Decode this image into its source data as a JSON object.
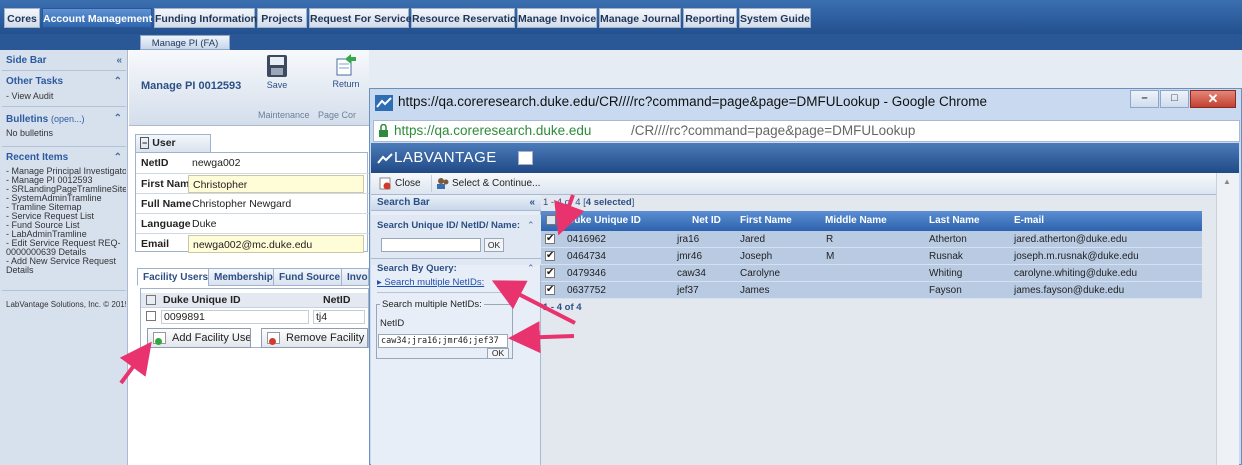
{
  "topnav": {
    "tabs": [
      {
        "label": "Cores"
      },
      {
        "label": "Account Management",
        "active": true
      },
      {
        "label": "Funding Information"
      },
      {
        "label": "Projects"
      },
      {
        "label": "Request For Service"
      },
      {
        "label": "Resource Reservation"
      },
      {
        "label": "Manage Invoice"
      },
      {
        "label": "Manage Journal"
      },
      {
        "label": "Reporting"
      },
      {
        "label": "System Guide"
      }
    ],
    "subtab": "Manage PI (FA)"
  },
  "sidebar": {
    "title": "Side Bar",
    "other_tasks_title": "Other Tasks",
    "other_tasks": [
      "- View Audit"
    ],
    "bulletins_title": "Bulletins",
    "bulletins_open": "(open...)",
    "bulletins_text": "No bulletins",
    "recent_title": "Recent Items",
    "recent_items": [
      "- Manage Principal Investigato",
      "- Manage PI 0012593",
      "- SRLandingPageTramlineSite",
      "- SystemAdminTramline",
      "- Tramline Sitemap",
      "- Service Request List",
      "- Fund Source List",
      "- LabAdminTramline",
      "- Edit Service Request REQ-",
      "  0000000639 Details",
      "- Add New Service Request",
      "  Details"
    ],
    "footer": "LabVantage Solutions, Inc. © 2015"
  },
  "header": {
    "title": "Manage PI 0012593",
    "save_label": "Save",
    "return_label": "Return",
    "group_maintenance": "Maintenance",
    "group_page": "Page Cor"
  },
  "user": {
    "section_title": "User",
    "fields": [
      {
        "label": "NetID",
        "value": "newga002"
      },
      {
        "label": "First Name",
        "value": "Christopher"
      },
      {
        "label": "Full Name",
        "value": "Christopher Newgard"
      },
      {
        "label": "Language",
        "value": "Duke"
      },
      {
        "label": "Email",
        "value": "newga002@mc.duke.edu"
      }
    ]
  },
  "facility": {
    "tabs": [
      "Facility Users",
      "Membership",
      "Fund Source",
      "Invo"
    ],
    "col_unique_id": "Duke Unique ID",
    "col_netid": "NetID",
    "row": {
      "unique_id": "0099891",
      "netid": "tj4"
    },
    "add_button": "Add Facility User",
    "remove_button": "Remove Facility U"
  },
  "popup": {
    "window_title": "https://qa.coreresearch.duke.edu/CR////rc?command=page&page=DMFULookup - Google Chrome",
    "url_host": "https://qa.coreresearch.duke.edu",
    "url_path": "/CR////rc?command=page&page=DMFULookup",
    "brand": "LABVANTAGE",
    "close_label": "Close",
    "select_label": "Select & Continue...",
    "search_bar_title": "Search Bar",
    "search_id_title": "Search Unique ID/ NetID/ Name:",
    "ok_label": "OK",
    "search_query_title": "Search By Query:",
    "search_multiple_link": "Search multiple NetIDs:",
    "search_multiple_legend": "Search multiple NetIDs:",
    "netid_label": "NetID",
    "netid_value": "caw34;jra16;jmr46;jef37",
    "pager_prefix": "1 - 4 of 4 [",
    "pager_selected": "4 selected",
    "pager_suffix": "]",
    "pager_bottom": "1 - 4 of 4",
    "columns": [
      "Duke Unique ID",
      "Net ID",
      "First Name",
      "Middle Name",
      "Last Name",
      "E-mail"
    ],
    "rows": [
      {
        "id": "0416962",
        "net": "jra16",
        "first": "Jared",
        "middle": "R",
        "last": "Atherton",
        "email": "jared.atherton@duke.edu"
      },
      {
        "id": "0464734",
        "net": "jmr46",
        "first": "Joseph",
        "middle": "M",
        "last": "Rusnak",
        "email": "joseph.m.rusnak@duke.edu"
      },
      {
        "id": "0479346",
        "net": "caw34",
        "first": "Carolyne",
        "middle": "",
        "last": "Whiting",
        "email": "carolyne.whiting@duke.edu"
      },
      {
        "id": "0637752",
        "net": "jef37",
        "first": "James",
        "middle": "",
        "last": "Fayson",
        "email": "james.fayson@duke.edu"
      }
    ]
  },
  "colors": {
    "nav_blue": "#2a5796",
    "annotation_pink": "#e8336e",
    "grid_header": "#3b71bb"
  }
}
